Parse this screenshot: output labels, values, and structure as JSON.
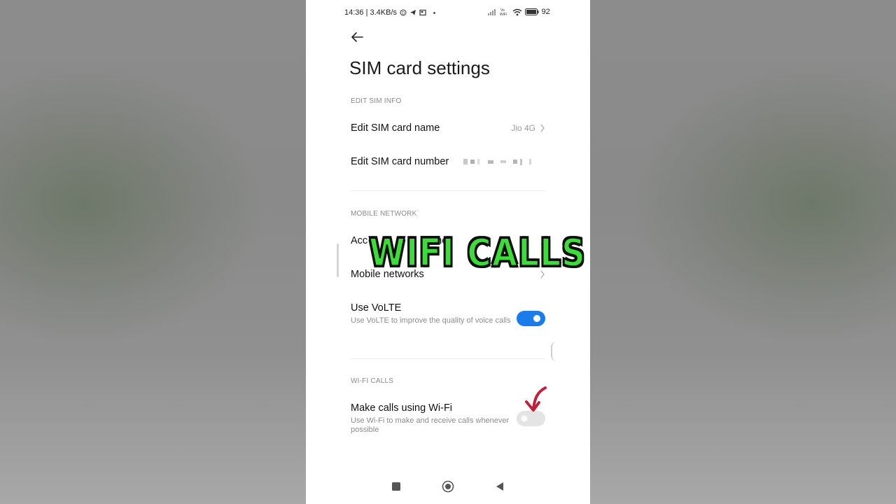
{
  "status_bar": {
    "time_speed": "14:36 | 3.4KB/s",
    "battery": "92"
  },
  "header": {
    "title": "SIM card settings"
  },
  "sections": {
    "edit_sim_info": {
      "header": "EDIT SIM INFO",
      "sim_name_label": "Edit SIM card name",
      "sim_name_value": "Jio 4G",
      "sim_number_label": "Edit SIM card number"
    },
    "mobile_network": {
      "header": "MOBILE NETWORK",
      "access_point_label": "Acc",
      "access_point_label_tail": "mes",
      "mobile_networks_label": "Mobile networks",
      "volte_title": "Use VoLTE",
      "volte_subtitle": "Use VoLTE to improve the quality of voice calls",
      "volte_enabled": true
    },
    "wifi_calls": {
      "header": "WI-FI CALLS",
      "wifi_call_title": "Make calls using Wi-Fi",
      "wifi_call_subtitle": "Use Wi-Fi to make and receive calls whenever possible",
      "wifi_call_enabled": false
    }
  },
  "overlay": {
    "caption": "WIFI CALLS",
    "caption_color": "#3ddc3a",
    "arrow_color": "#c0213a"
  },
  "colors": {
    "accent": "#1a7bea",
    "background": "#ffffff",
    "secondary_text": "#8d8d8d"
  }
}
